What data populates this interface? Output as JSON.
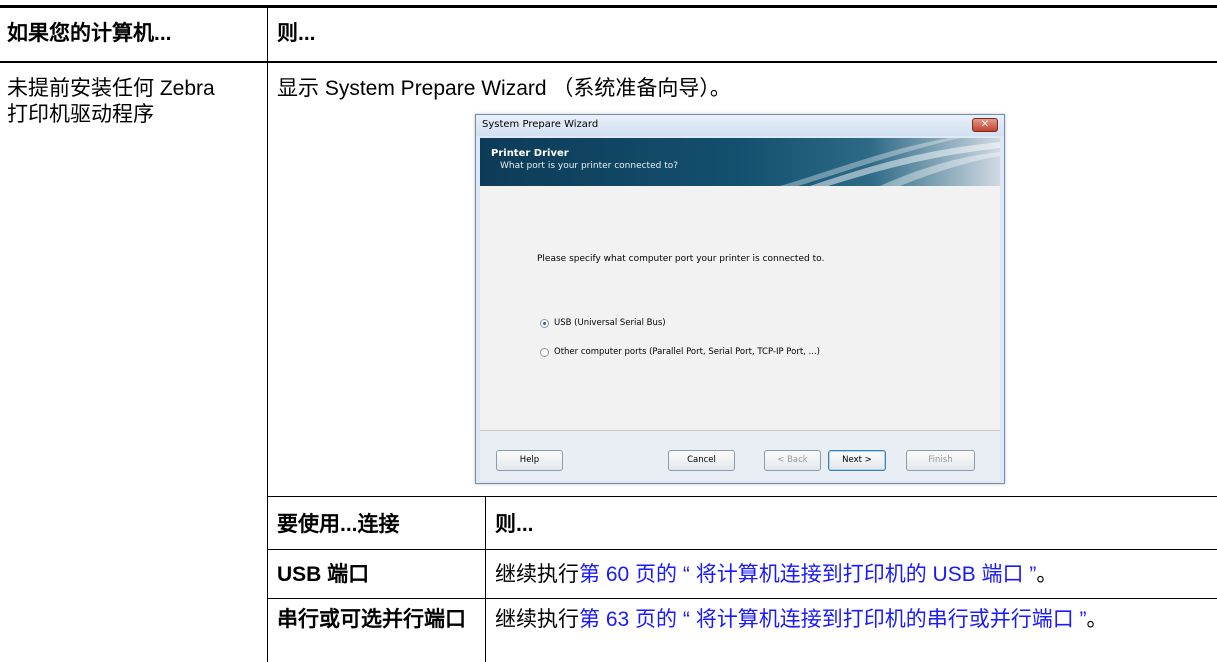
{
  "table": {
    "header_col1": "如果您的计算机...",
    "header_col2": "则...",
    "row1_col1": "未提前安装任何 Zebra 打印机驱动程序",
    "row1_col2": "显示 System Prepare Wizard （系统准备向导）。"
  },
  "wizard": {
    "window_title": "System Prepare Wizard",
    "close_label": "✕",
    "banner_title": "Printer Driver",
    "banner_subtitle": "What port is your printer connected to?",
    "prompt": "Please specify what computer port your printer is connected to.",
    "options": [
      {
        "label": "USB (Universal Serial Bus)",
        "selected": true
      },
      {
        "label": "Other computer ports (Parallel Port, Serial Port, TCP-IP Port, ...)",
        "selected": false
      }
    ],
    "buttons": {
      "help": "Help",
      "cancel": "Cancel",
      "back": "< Back",
      "next": "Next >",
      "finish": "Finish"
    }
  },
  "subtable": {
    "header_col1": "要使用...连接",
    "header_col2": "则...",
    "rows": [
      {
        "col1": "USB 端口",
        "prefix": "继续执行",
        "link": "第 60 页的 “ 将计算机连接到打印机的 USB 端口 ”",
        "suffix": "。"
      },
      {
        "col1": "串行或可选并行端口",
        "prefix": "继续执行",
        "link": "第 63 页的 “ 将计算机连接到打印机的串行或并行端口 ”",
        "suffix": "。"
      }
    ]
  },
  "colors": {
    "link": "#1a1aff",
    "banner": "#13506f"
  }
}
